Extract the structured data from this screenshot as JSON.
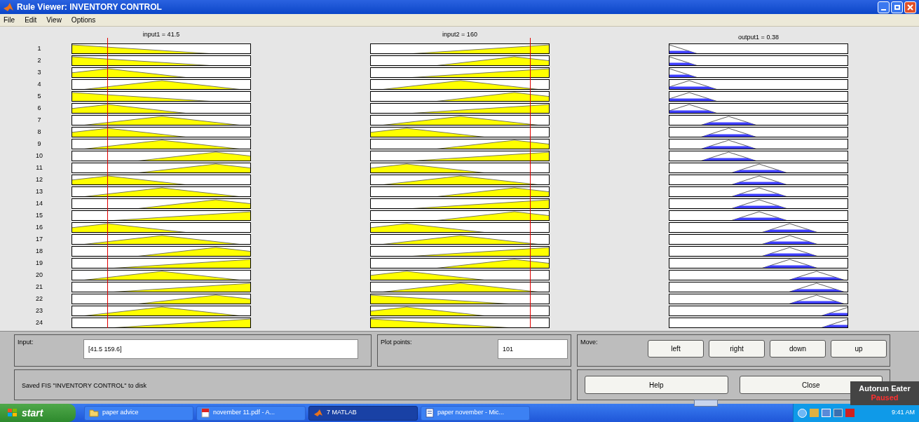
{
  "window": {
    "title": "Rule Viewer: INVENTORY CONTROL"
  },
  "menu": [
    "File",
    "Edit",
    "View",
    "Options"
  ],
  "columns": [
    {
      "title": "input1 = 41.5",
      "kind": "input",
      "level": 0.2
    },
    {
      "title": "input2 = 160",
      "kind": "input",
      "level": 0.89
    },
    {
      "title": "output1 = 0.38",
      "kind": "output"
    }
  ],
  "rules": [
    {
      "number": "1",
      "plots": [
        {
          "kind": "z"
        },
        {
          "kind": "s"
        },
        {
          "kind": "o1"
        }
      ]
    },
    {
      "number": "2",
      "plots": [
        {
          "kind": "z"
        },
        {
          "kind": "high"
        },
        {
          "kind": "o1"
        }
      ]
    },
    {
      "number": "3",
      "plots": [
        {
          "kind": "low"
        },
        {
          "kind": "s"
        },
        {
          "kind": "o1"
        }
      ]
    },
    {
      "number": "4",
      "plots": [
        {
          "kind": "mid"
        },
        {
          "kind": "mid"
        },
        {
          "kind": "o2"
        }
      ]
    },
    {
      "number": "5",
      "plots": [
        {
          "kind": "z"
        },
        {
          "kind": "high"
        },
        {
          "kind": "o2"
        }
      ]
    },
    {
      "number": "6",
      "plots": [
        {
          "kind": "low"
        },
        {
          "kind": "s"
        },
        {
          "kind": "o2"
        }
      ]
    },
    {
      "number": "7",
      "plots": [
        {
          "kind": "mid"
        },
        {
          "kind": "mid"
        },
        {
          "kind": "o3"
        }
      ]
    },
    {
      "number": "8",
      "plots": [
        {
          "kind": "low"
        },
        {
          "kind": "low"
        },
        {
          "kind": "o3"
        }
      ]
    },
    {
      "number": "9",
      "plots": [
        {
          "kind": "mid"
        },
        {
          "kind": "high"
        },
        {
          "kind": "o3"
        }
      ]
    },
    {
      "number": "10",
      "plots": [
        {
          "kind": "high"
        },
        {
          "kind": "s"
        },
        {
          "kind": "o3"
        }
      ]
    },
    {
      "number": "11",
      "plots": [
        {
          "kind": "high"
        },
        {
          "kind": "low"
        },
        {
          "kind": "o4"
        }
      ]
    },
    {
      "number": "12",
      "plots": [
        {
          "kind": "low"
        },
        {
          "kind": "mid"
        },
        {
          "kind": "o4"
        }
      ]
    },
    {
      "number": "13",
      "plots": [
        {
          "kind": "mid"
        },
        {
          "kind": "high"
        },
        {
          "kind": "o4"
        }
      ]
    },
    {
      "number": "14",
      "plots": [
        {
          "kind": "high"
        },
        {
          "kind": "s"
        },
        {
          "kind": "o4"
        }
      ]
    },
    {
      "number": "15",
      "plots": [
        {
          "kind": "s"
        },
        {
          "kind": "high"
        },
        {
          "kind": "o4"
        }
      ]
    },
    {
      "number": "16",
      "plots": [
        {
          "kind": "low"
        },
        {
          "kind": "low"
        },
        {
          "kind": "o5"
        }
      ]
    },
    {
      "number": "17",
      "plots": [
        {
          "kind": "mid"
        },
        {
          "kind": "mid"
        },
        {
          "kind": "o5"
        }
      ]
    },
    {
      "number": "18",
      "plots": [
        {
          "kind": "high"
        },
        {
          "kind": "s"
        },
        {
          "kind": "o5"
        }
      ]
    },
    {
      "number": "19",
      "plots": [
        {
          "kind": "s"
        },
        {
          "kind": "high"
        },
        {
          "kind": "o5"
        }
      ]
    },
    {
      "number": "20",
      "plots": [
        {
          "kind": "mid"
        },
        {
          "kind": "low"
        },
        {
          "kind": "o6"
        }
      ]
    },
    {
      "number": "21",
      "plots": [
        {
          "kind": "s"
        },
        {
          "kind": "mid"
        },
        {
          "kind": "o6"
        }
      ]
    },
    {
      "number": "22",
      "plots": [
        {
          "kind": "high"
        },
        {
          "kind": "z"
        },
        {
          "kind": "o6"
        }
      ]
    },
    {
      "number": "23",
      "plots": [
        {
          "kind": "mid"
        },
        {
          "kind": "low"
        },
        {
          "kind": "o7"
        }
      ]
    },
    {
      "number": "24",
      "plots": [
        {
          "kind": "s"
        },
        {
          "kind": "z"
        },
        {
          "kind": "o7"
        }
      ]
    }
  ],
  "input_field": {
    "label": "Input:",
    "value": "[41.5 159.6]"
  },
  "plot_points": {
    "label": "Plot points:",
    "value": "101"
  },
  "move": {
    "label": "Move:",
    "buttons": [
      "left",
      "right",
      "down",
      "up"
    ]
  },
  "status": "Saved FIS \"INVENTORY CONTROL\" to disk",
  "buttons": [
    "Help",
    "Close"
  ],
  "overlay": {
    "title": "Autorun Eater",
    "state": "Paused"
  },
  "taskbar": {
    "start": "start",
    "items": [
      {
        "label": "paper advice",
        "kind": "folder",
        "selected": false
      },
      {
        "label": "november 11.pdf - A...",
        "kind": "pdf",
        "selected": false
      },
      {
        "label": "7 MATLAB",
        "kind": "matlab",
        "selected": true
      },
      {
        "label": "paper november - Mic...",
        "kind": "word",
        "selected": false
      }
    ],
    "clock": "9:41 AM"
  }
}
